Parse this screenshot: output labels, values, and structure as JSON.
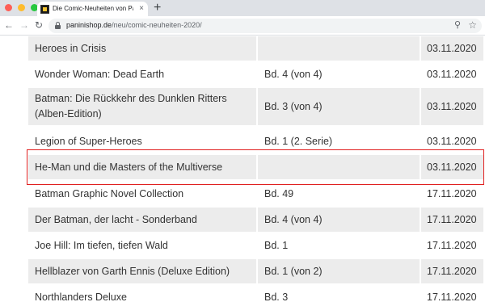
{
  "browser": {
    "tab_title": "Die Comic-Neuheiten von Panini",
    "tab_close": "×",
    "new_tab": "+",
    "nav_back": "←",
    "nav_forward": "→",
    "nav_reload": "↻",
    "url_domain": "paninishop.de",
    "url_path": "/neu/comic-neuheiten-2020/",
    "zoom_icon": "⚲",
    "star_icon": "☆"
  },
  "table": {
    "rows": [
      {
        "title": "Heroes in Crisis",
        "volume": "",
        "date": "03.11.2020"
      },
      {
        "title": "Wonder Woman: Dead Earth",
        "volume": "Bd. 4 (von 4)",
        "date": "03.11.2020"
      },
      {
        "title": "Batman: Die Rückkehr des Dunklen Ritters (Alben-Edition)",
        "volume": "Bd. 3 (von 4)",
        "date": "03.11.2020"
      },
      {
        "title": "Legion of Super-Heroes",
        "volume": "Bd. 1 (2. Serie)",
        "date": "03.11.2020"
      },
      {
        "title": "He-Man und die Masters of the Multiverse",
        "volume": "",
        "date": "03.11.2020"
      },
      {
        "title": "Batman Graphic Novel Collection",
        "volume": "Bd. 49",
        "date": "17.11.2020"
      },
      {
        "title": "Der Batman, der lacht - Sonderband",
        "volume": "Bd. 4 (von 4)",
        "date": "17.11.2020"
      },
      {
        "title": "Joe Hill: Im tiefen, tiefen Wald",
        "volume": "Bd. 1",
        "date": "17.11.2020"
      },
      {
        "title": "Hellblazer von Garth Ennis (Deluxe Edition)",
        "volume": "Bd. 1 (von 2)",
        "date": "17.11.2020"
      },
      {
        "title": "Northlanders Deluxe",
        "volume": "Bd. 3",
        "date": "17.11.2020"
      }
    ]
  },
  "colors": {
    "highlight_border": "#e02020",
    "row_shade": "#ececec"
  }
}
